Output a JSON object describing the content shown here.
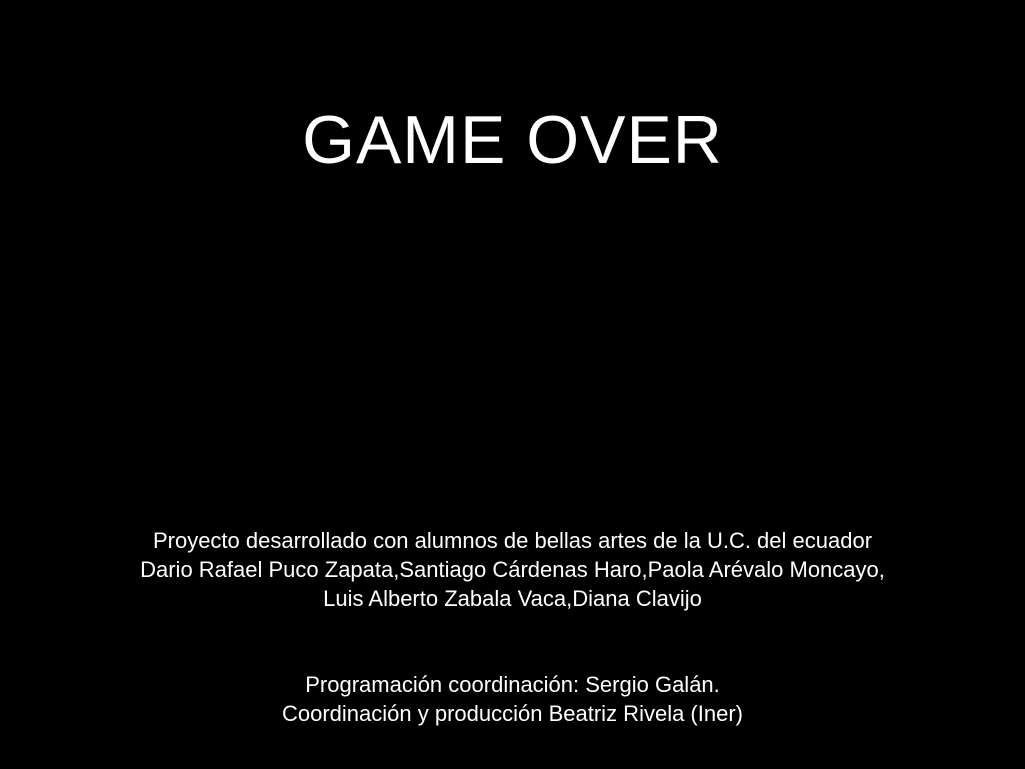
{
  "screen": {
    "title": "GAME OVER",
    "background_color": "#000000",
    "text_color": "#ffffff"
  },
  "credits": {
    "lines": [
      "Proyecto desarrollado con alumnos de bellas artes de la U.C. del ecuador",
      "Dario Rafael Puco Zapata,Santiago Cárdenas Haro,Paola Arévalo Moncayo,",
      "Luis Alberto Zabala Vaca,Diana Clavijo"
    ]
  },
  "staff": {
    "lines": [
      "Programación coordinación: Sergio Galán.",
      "Coordinación y producción Beatriz Rivela (Iner)"
    ]
  }
}
